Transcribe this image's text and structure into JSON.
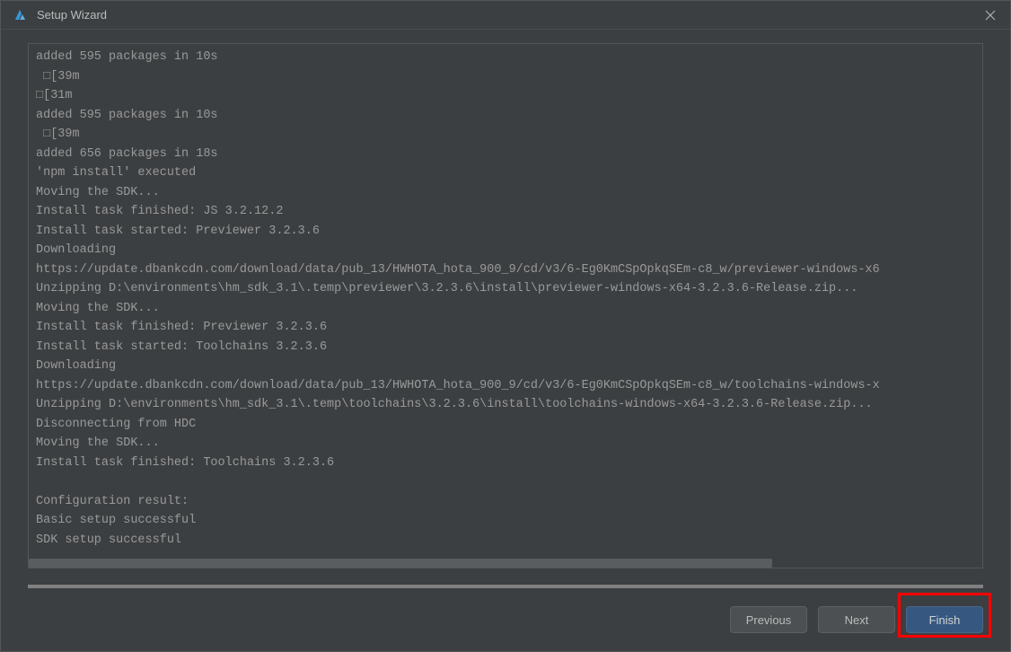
{
  "window": {
    "title": "Setup Wizard"
  },
  "log": {
    "lines": [
      "added 595 packages in 10s",
      " □[39m",
      "□[31m",
      "added 595 packages in 10s",
      " □[39m",
      "added 656 packages in 18s",
      "'npm install' executed",
      "Moving the SDK...",
      "Install task finished: JS 3.2.12.2",
      "Install task started: Previewer 3.2.3.6",
      "Downloading",
      "https://update.dbankcdn.com/download/data/pub_13/HWHOTA_hota_900_9/cd/v3/6-Eg0KmCSpOpkqSEm-c8_w/previewer-windows-x6",
      "Unzipping D:\\environments\\hm_sdk_3.1\\.temp\\previewer\\3.2.3.6\\install\\previewer-windows-x64-3.2.3.6-Release.zip...",
      "Moving the SDK...",
      "Install task finished: Previewer 3.2.3.6",
      "Install task started: Toolchains 3.2.3.6",
      "Downloading",
      "https://update.dbankcdn.com/download/data/pub_13/HWHOTA_hota_900_9/cd/v3/6-Eg0KmCSpOpkqSEm-c8_w/toolchains-windows-x",
      "Unzipping D:\\environments\\hm_sdk_3.1\\.temp\\toolchains\\3.2.3.6\\install\\toolchains-windows-x64-3.2.3.6-Release.zip...",
      "Disconnecting from HDC",
      "Moving the SDK...",
      "Install task finished: Toolchains 3.2.3.6",
      "",
      "Configuration result:",
      "Basic setup successful",
      "SDK setup successful"
    ]
  },
  "buttons": {
    "previous": "Previous",
    "next": "Next",
    "finish": "Finish"
  }
}
